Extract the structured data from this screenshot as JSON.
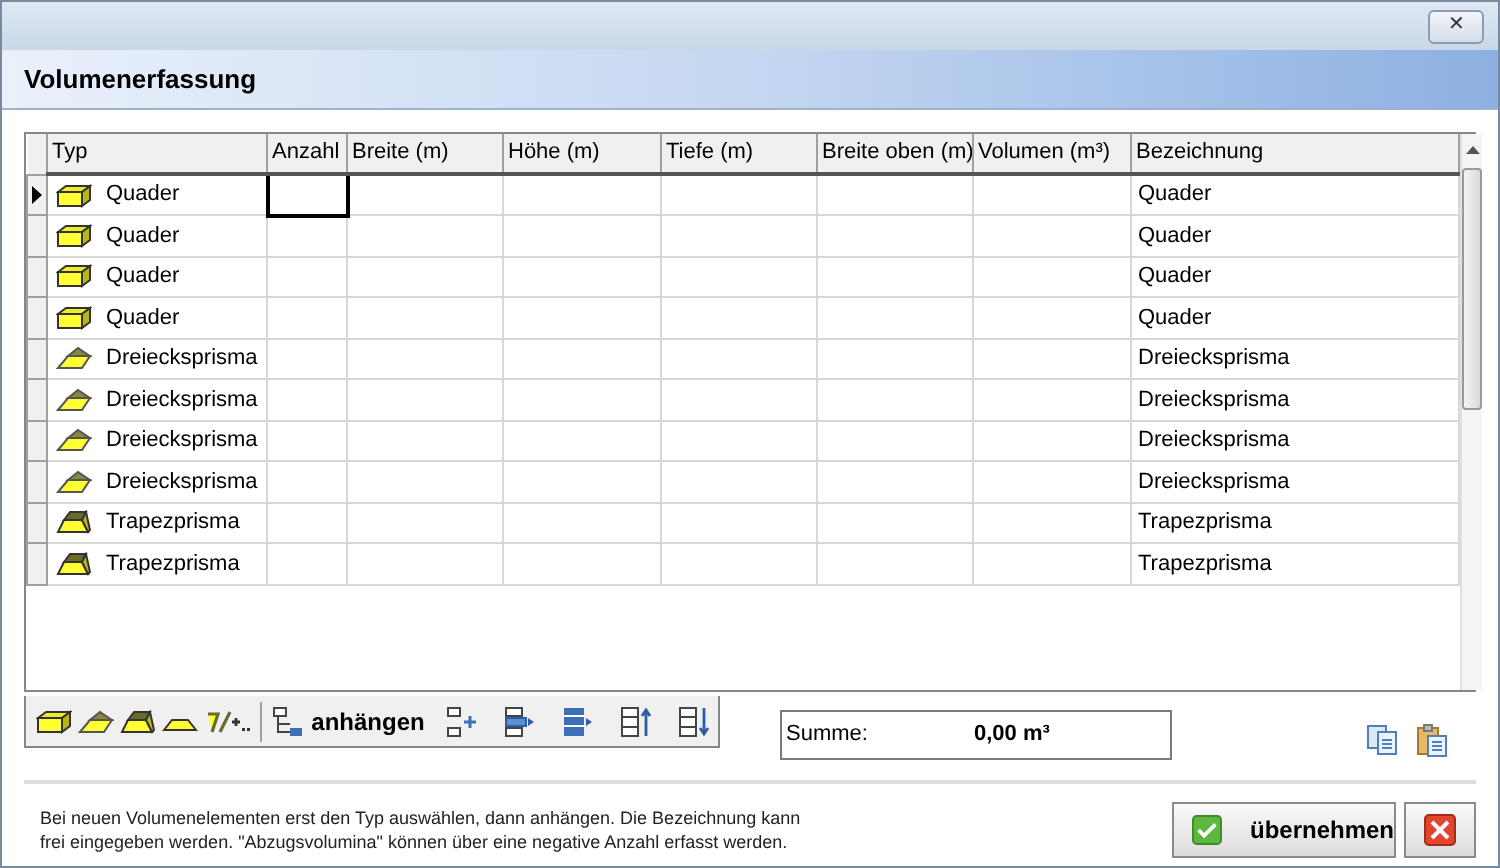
{
  "window": {
    "close_label": "✕"
  },
  "header": {
    "title": "Volumenerfassung"
  },
  "table": {
    "columns": [
      "Typ",
      "Anzahl",
      "Breite (m)",
      "Höhe (m)",
      "Tiefe (m)",
      "Breite oben (m)",
      "Volumen (m³)",
      "Bezeichnung"
    ],
    "rows": [
      {
        "kind": "quader",
        "typ": "Quader",
        "bezeichnung": "Quader",
        "selected": true
      },
      {
        "kind": "quader",
        "typ": "Quader",
        "bezeichnung": "Quader",
        "selected": false
      },
      {
        "kind": "quader",
        "typ": "Quader",
        "bezeichnung": "Quader",
        "selected": false
      },
      {
        "kind": "quader",
        "typ": "Quader",
        "bezeichnung": "Quader",
        "selected": false
      },
      {
        "kind": "dreieck",
        "typ": "Dreiecksprisma",
        "bezeichnung": "Dreiecksprisma",
        "selected": false
      },
      {
        "kind": "dreieck",
        "typ": "Dreiecksprisma",
        "bezeichnung": "Dreiecksprisma",
        "selected": false
      },
      {
        "kind": "dreieck",
        "typ": "Dreiecksprisma",
        "bezeichnung": "Dreiecksprisma",
        "selected": false
      },
      {
        "kind": "dreieck",
        "typ": "Dreiecksprisma",
        "bezeichnung": "Dreiecksprisma",
        "selected": false
      },
      {
        "kind": "trapez",
        "typ": "Trapezprisma",
        "bezeichnung": "Trapezprisma",
        "selected": false
      },
      {
        "kind": "trapez",
        "typ": "Trapezprisma",
        "bezeichnung": "Trapezprisma",
        "selected": false
      }
    ]
  },
  "toolbar": {
    "append_label": "anhängen"
  },
  "sum": {
    "label": "Summe:",
    "value": "0,00 m³"
  },
  "hint": "Bei neuen Volumenelementen erst den Typ auswählen, dann anhängen. Die Bezeichnung kann frei eingegeben werden. \"Abzugsvolumina\" können über eine negative Anzahl erfasst werden.",
  "buttons": {
    "accept": "übernehmen"
  }
}
